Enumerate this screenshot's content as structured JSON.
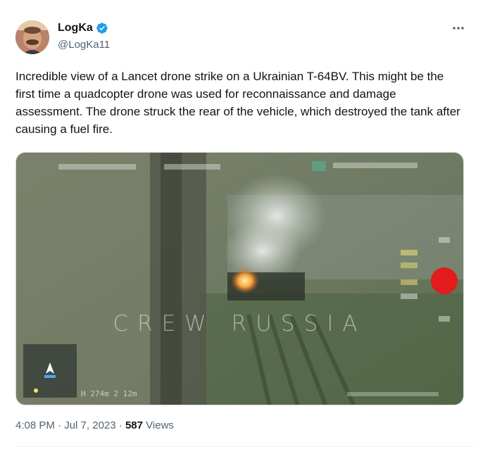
{
  "author": {
    "display_name": "LogKa",
    "handle": "@LogKa11",
    "verified_icon": "verified-badge-icon",
    "avatar_icon": "avatar-image"
  },
  "more_icon": "more-options-icon",
  "tweet": {
    "text": "Incredible view of a Lancet drone strike on a Ukrainian T-64BV. This might be the first time a quadcopter drone was used for reconnaissance and damage assessment. The drone struck the rear of the vehicle, which destroyed the tank after causing a fuel fire."
  },
  "media": {
    "watermark": "CREW RUSSIA",
    "hud_bottom_text": "H 274m   2 12m"
  },
  "meta": {
    "time": "4:08 PM",
    "separator": "·",
    "date": "Jul 7, 2023",
    "views_count": "587",
    "views_label": "Views"
  },
  "colors": {
    "verified_blue": "#1d9bf0",
    "text_primary": "#0f1419",
    "text_secondary": "#536471"
  }
}
